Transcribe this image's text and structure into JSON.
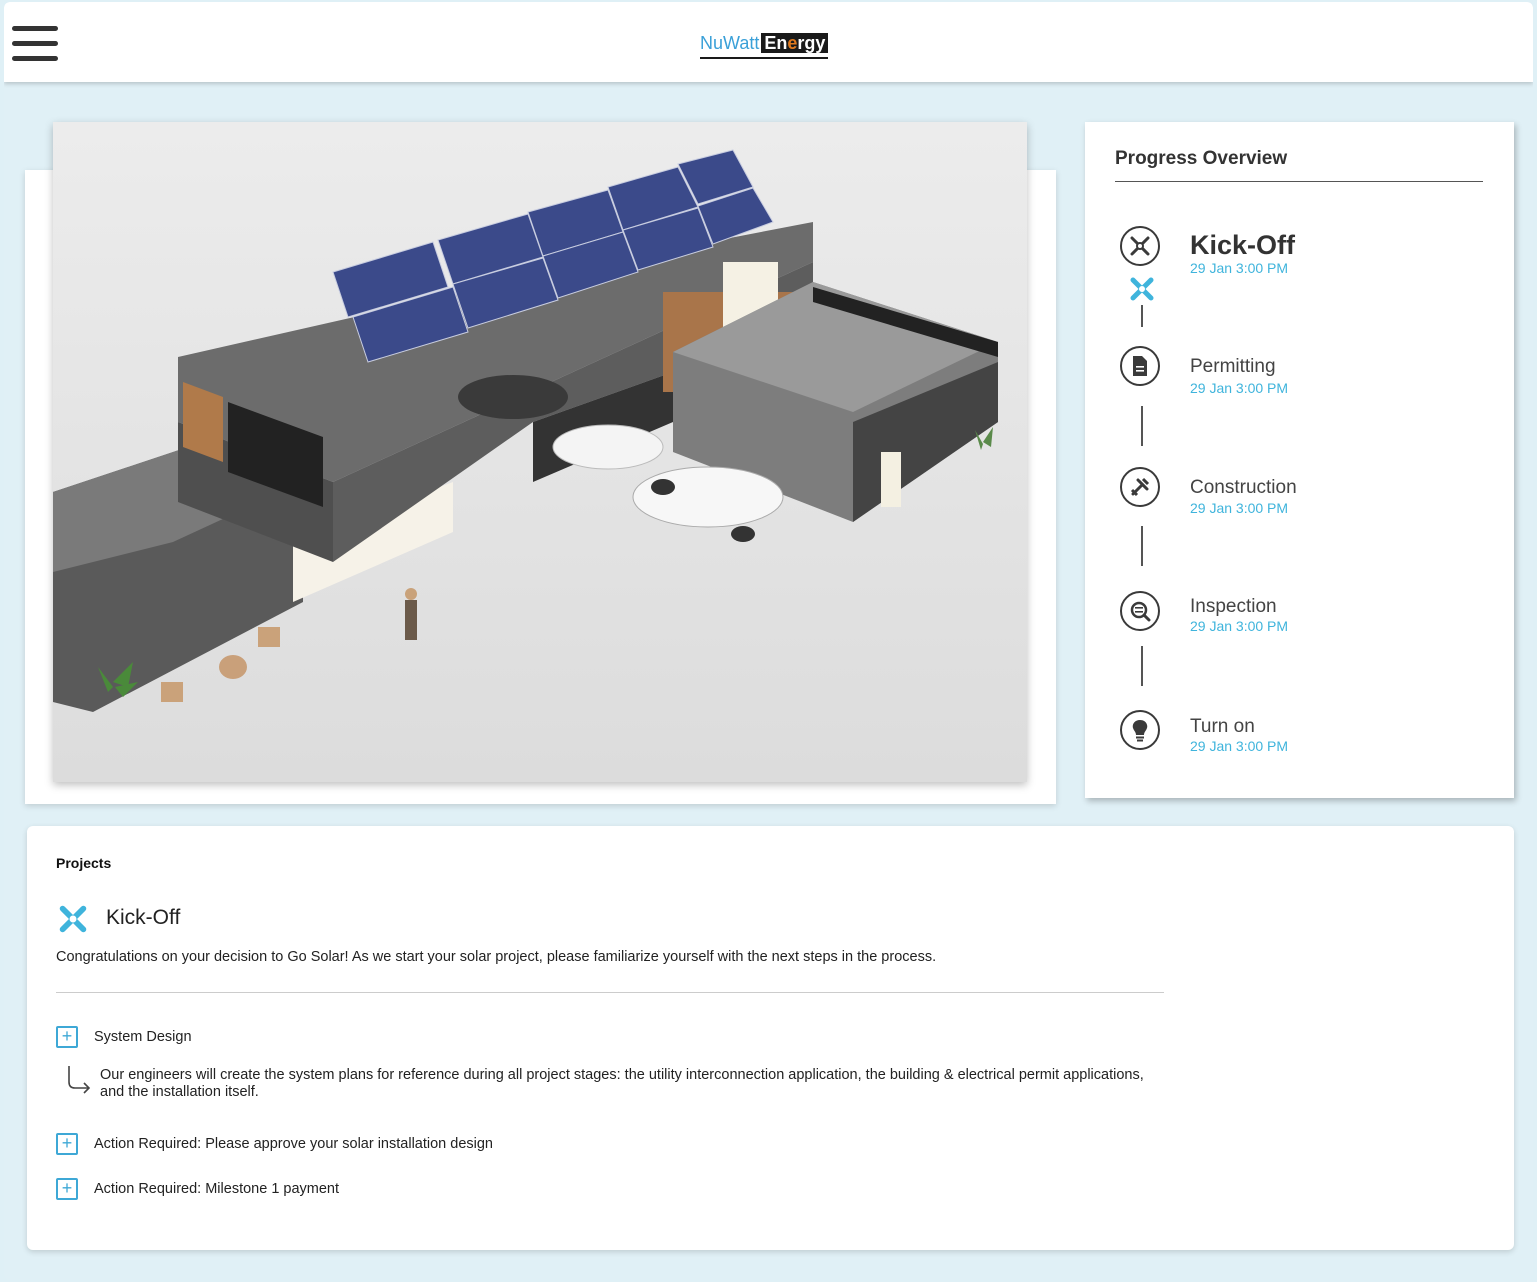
{
  "header": {
    "logo_nu": "NuWatt",
    "logo_en_pre": "En",
    "logo_en_mid": "e",
    "logo_en_post": "rgy"
  },
  "progress": {
    "title": "Progress Overview",
    "steps": [
      {
        "name": "Kick-Off",
        "date": "29 Jan 3:00 PM",
        "icon": "kickoff-tools-icon",
        "active": true
      },
      {
        "name": "Permitting",
        "date": "29 Jan 3:00 PM",
        "icon": "document-icon",
        "active": false
      },
      {
        "name": "Construction",
        "date": "29 Jan 3:00 PM",
        "icon": "tools-icon",
        "active": false
      },
      {
        "name": "Inspection",
        "date": "29 Jan 3:00 PM",
        "icon": "inspect-search-icon",
        "active": false
      },
      {
        "name": "Turn on",
        "date": "29 Jan 3:00 PM",
        "icon": "lightbulb-icon",
        "active": false
      }
    ]
  },
  "projects": {
    "label": "Projects",
    "current_stage": "Kick-Off",
    "description": "Congratulations on your decision to Go Solar! As we start your solar project, please familiarize yourself with the next steps in the process.",
    "items": [
      {
        "label": "System Design",
        "detail": "Our engineers will create the system plans for reference during all project stages: the utility interconnection application, the building & electrical permit applications, and the installation itself."
      },
      {
        "label": "Action Required: Please approve your solar installation design"
      },
      {
        "label": "Action Required: Milestone 1 payment"
      }
    ]
  },
  "colors": {
    "accent": "#3fb4dc",
    "background": "#e0f0f6",
    "text": "#333333"
  }
}
